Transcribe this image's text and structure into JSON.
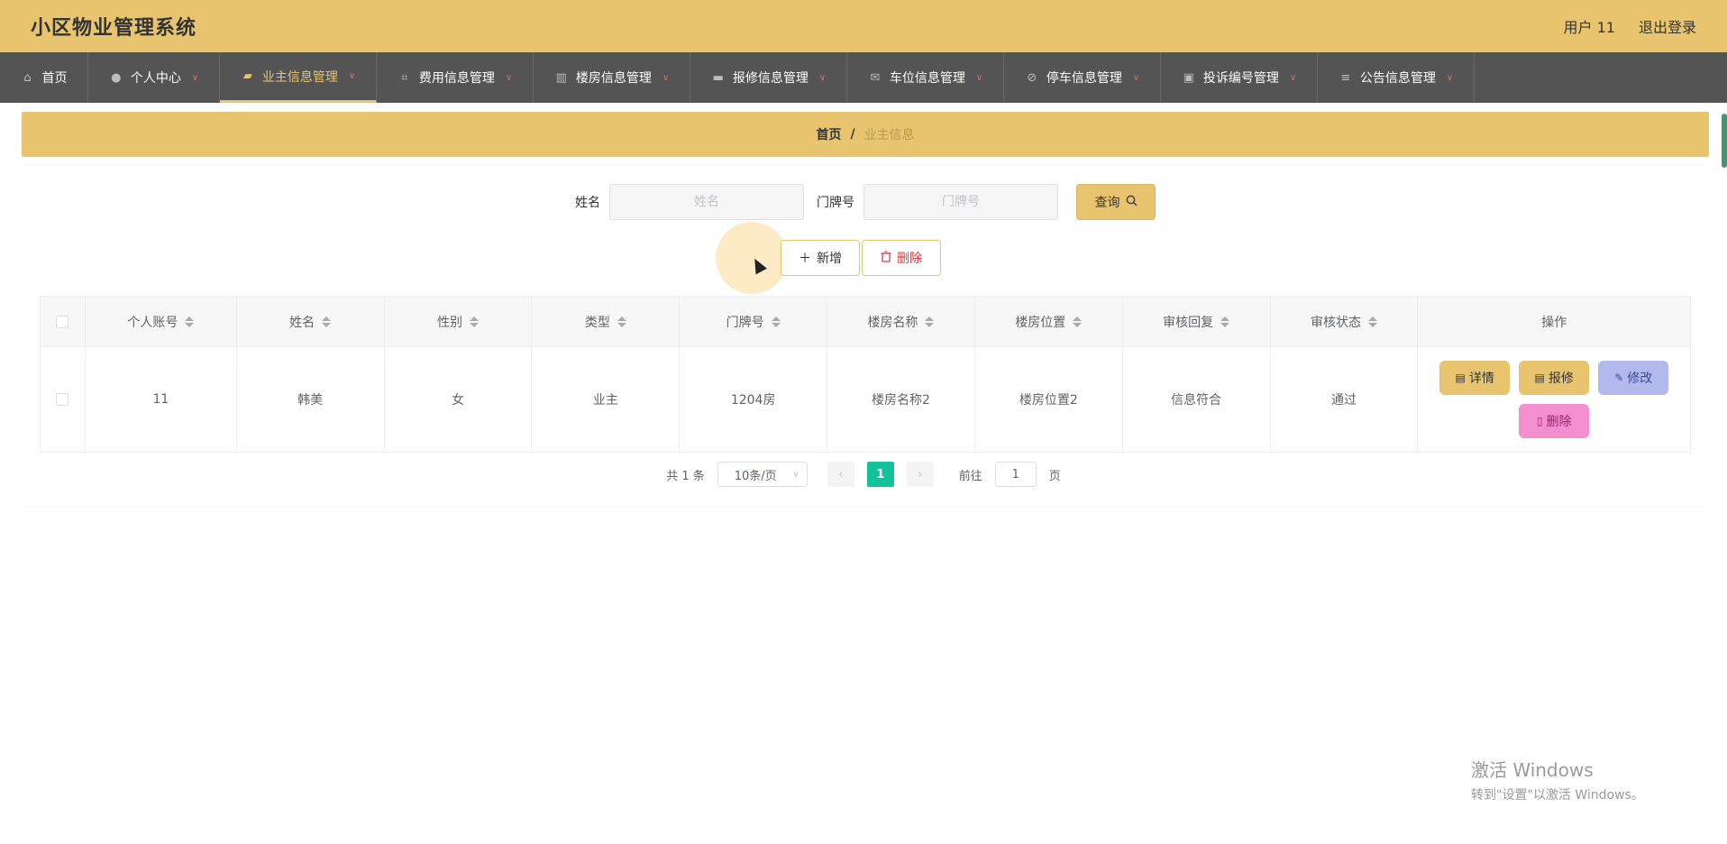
{
  "header": {
    "title": "小区物业管理系统",
    "user": "用户 11",
    "logout": "退出登录"
  },
  "nav": [
    {
      "label": "首页",
      "icon": "home-icon",
      "glyph": "⌂",
      "chev": false,
      "active": false
    },
    {
      "label": "个人中心",
      "icon": "user-icon",
      "glyph": "●",
      "chev": true,
      "active": false
    },
    {
      "label": "业主信息管理",
      "icon": "owner-icon",
      "glyph": "▰",
      "chev": true,
      "active": true
    },
    {
      "label": "费用信息管理",
      "icon": "crop-icon",
      "glyph": "⌗",
      "chev": true,
      "active": false
    },
    {
      "label": "楼房信息管理",
      "icon": "building-icon",
      "glyph": "▥",
      "chev": true,
      "active": false
    },
    {
      "label": "报修信息管理",
      "icon": "message-icon",
      "glyph": "▬",
      "chev": true,
      "active": false
    },
    {
      "label": "车位信息管理",
      "icon": "mail-icon",
      "glyph": "✉",
      "chev": true,
      "active": false
    },
    {
      "label": "停车信息管理",
      "icon": "bell-off-icon",
      "glyph": "⊘",
      "chev": true,
      "active": false
    },
    {
      "label": "投诉编号管理",
      "icon": "briefcase-icon",
      "glyph": "▣",
      "chev": true,
      "active": false
    },
    {
      "label": "公告信息管理",
      "icon": "sliders-icon",
      "glyph": "≡",
      "chev": true,
      "active": false
    }
  ],
  "breadcrumb": {
    "home": "首页",
    "sep": "/",
    "current": "业主信息"
  },
  "search": {
    "name_label": "姓名",
    "name_placeholder": "姓名",
    "door_label": "门牌号",
    "door_placeholder": "门牌号",
    "query": "查询"
  },
  "actions": {
    "add": "新增",
    "delete": "删除"
  },
  "table": {
    "columns": [
      "个人账号",
      "姓名",
      "性别",
      "类型",
      "门牌号",
      "楼房名称",
      "楼房位置",
      "审核回复",
      "审核状态",
      "操作"
    ],
    "rows": [
      {
        "cells": [
          "11",
          "韩美",
          "女",
          "业主",
          "1204房",
          "楼房名称2",
          "楼房位置2",
          "信息符合",
          "通过"
        ]
      }
    ],
    "row_actions": {
      "detail": "详情",
      "repair": "报修",
      "edit": "修改",
      "delete": "删除"
    }
  },
  "pagination": {
    "total": "共 1 条",
    "size": "10条/页",
    "page": "1",
    "goto_prefix": "前往",
    "goto_value": "1",
    "goto_suffix": "页"
  },
  "watermark": {
    "line1": "激活 Windows",
    "line2": "转到\"设置\"以激活 Windows。"
  }
}
